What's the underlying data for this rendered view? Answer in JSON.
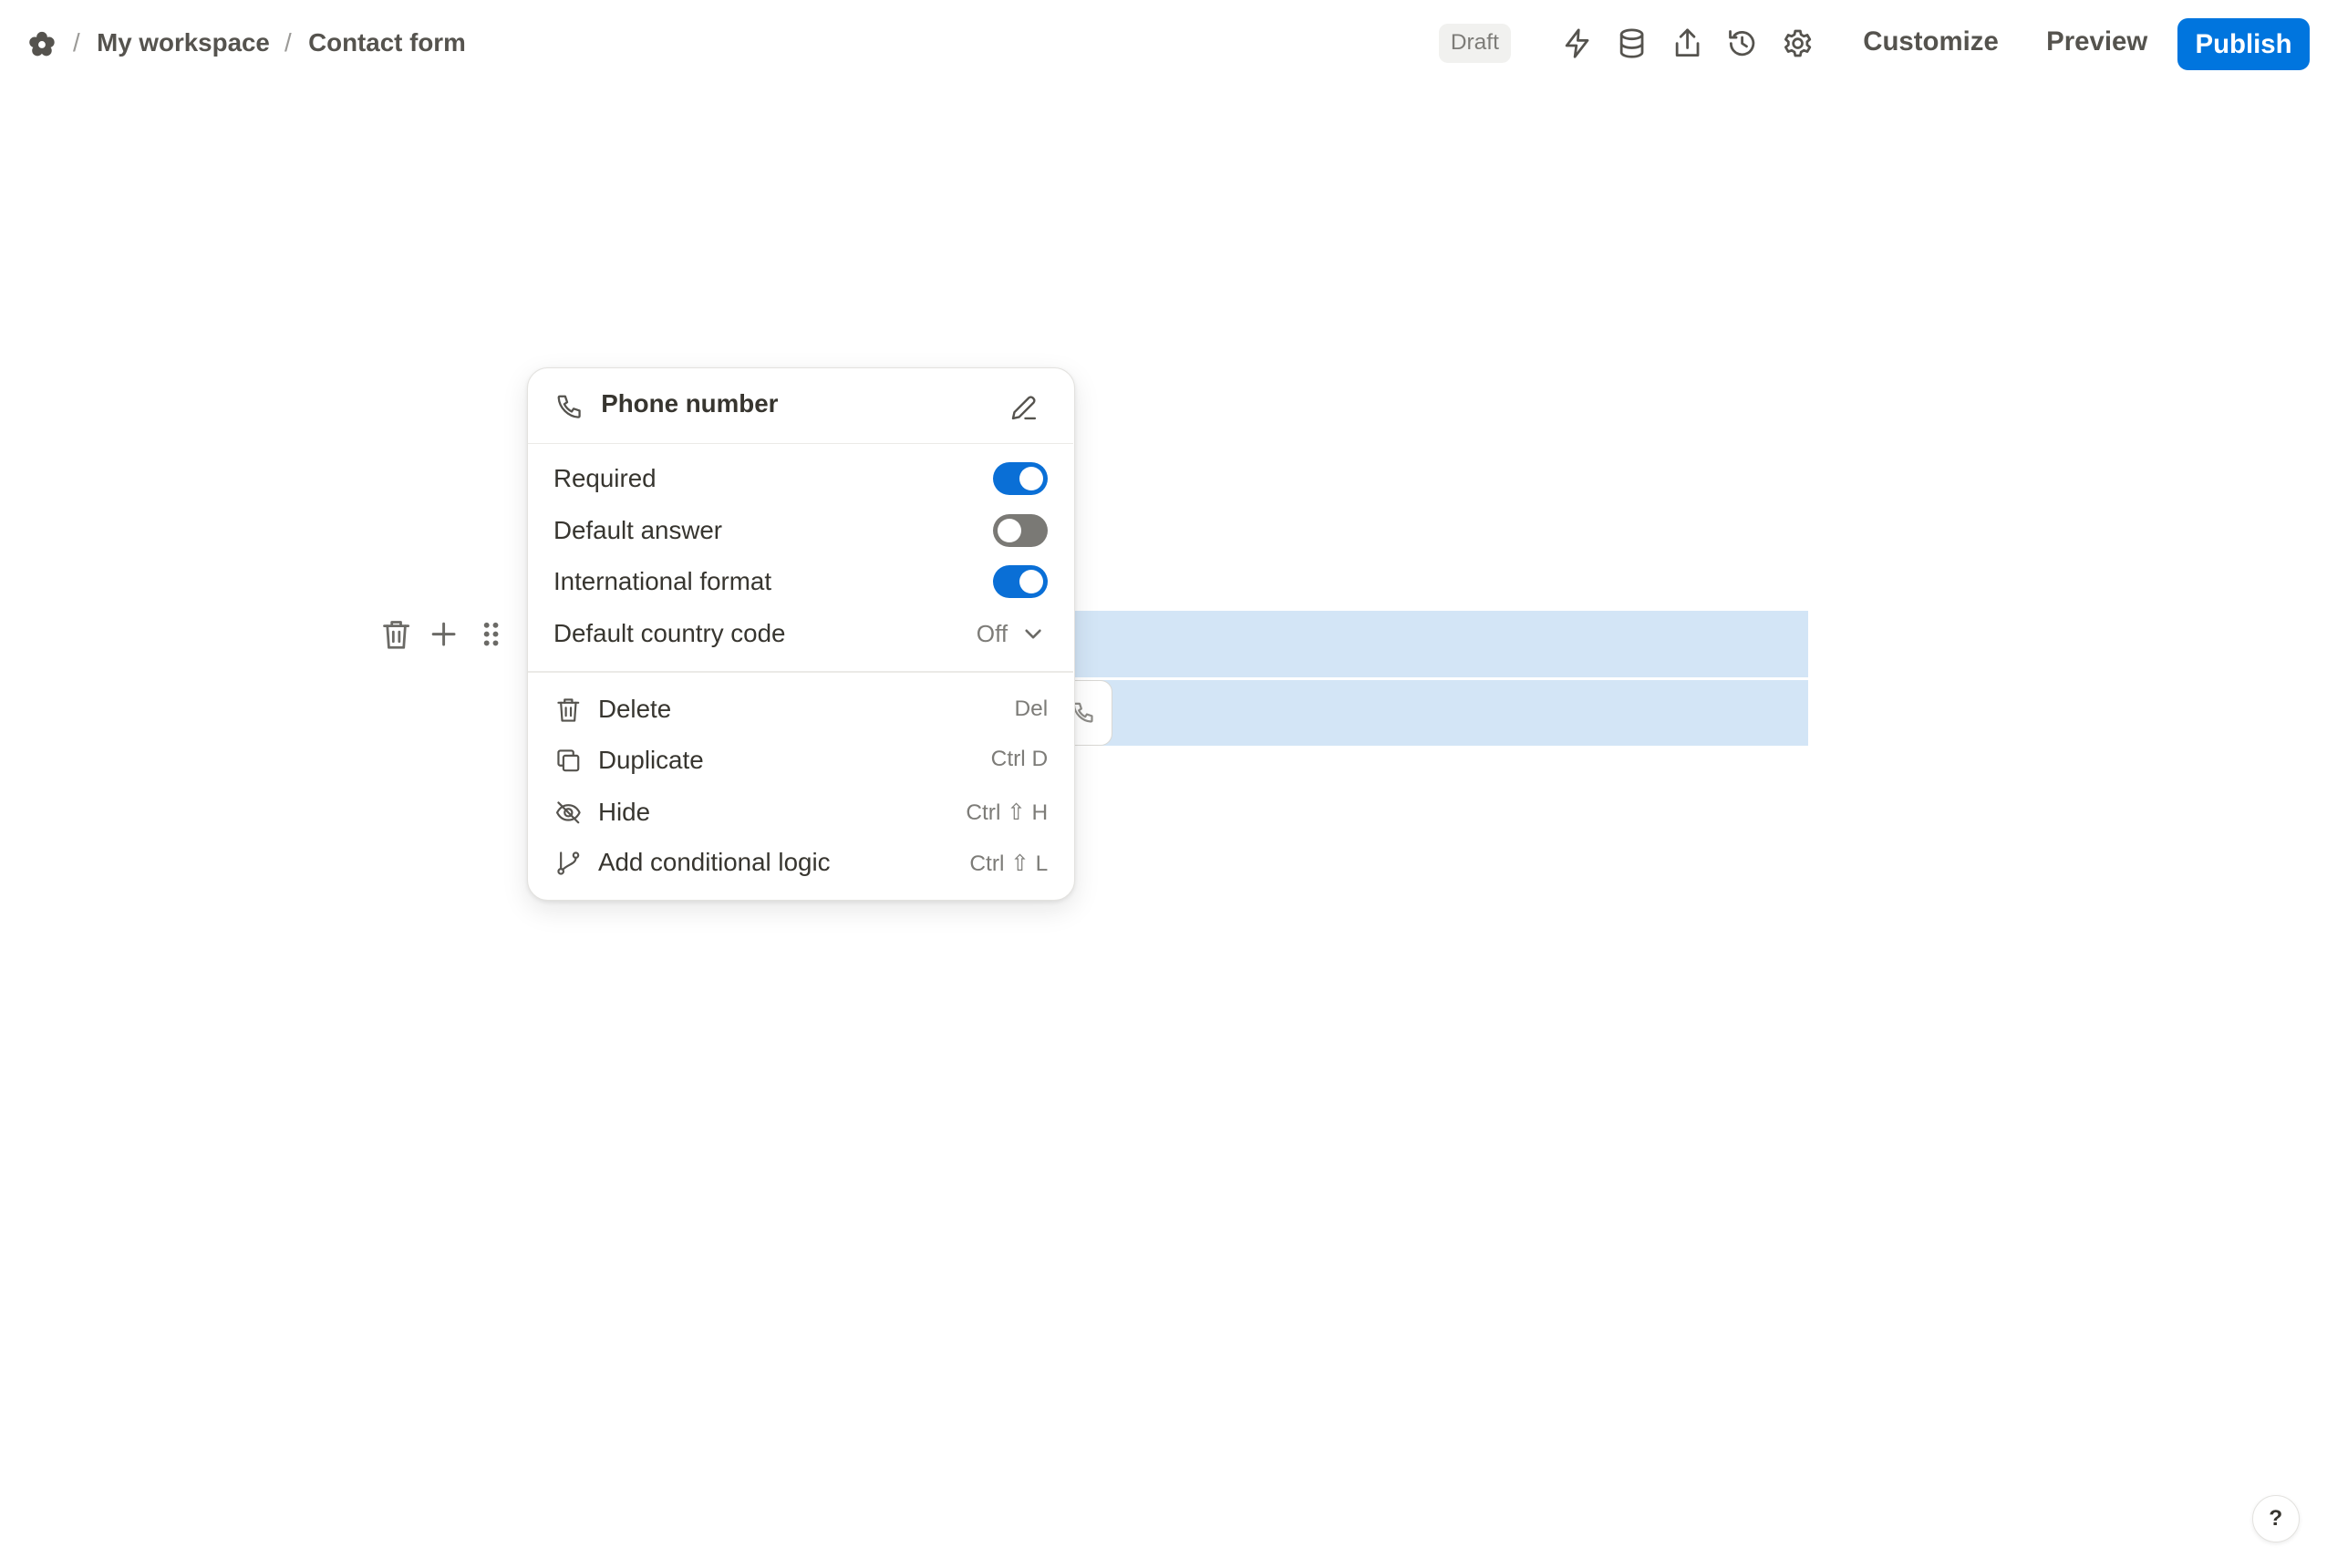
{
  "breadcrumb": {
    "separator": "/",
    "workspace": "My workspace",
    "page": "Contact form"
  },
  "topbar": {
    "status_badge": "Draft",
    "icons": [
      "bolt-icon",
      "database-icon",
      "share-icon",
      "history-icon",
      "gear-icon"
    ],
    "customize_label": "Customize",
    "preview_label": "Preview",
    "publish_label": "Publish"
  },
  "block_controls": [
    "trash-icon",
    "plus-icon",
    "drag-handle-icon"
  ],
  "field_menu": {
    "title": "Phone number",
    "options": {
      "required": {
        "label": "Required",
        "enabled": true
      },
      "default_answer": {
        "label": "Default answer",
        "enabled": false
      },
      "international_format": {
        "label": "International format",
        "enabled": true
      },
      "default_country_code": {
        "label": "Default country code",
        "value": "Off"
      }
    },
    "actions": {
      "delete": {
        "label": "Delete",
        "shortcut": "Del"
      },
      "duplicate": {
        "label": "Duplicate",
        "shortcut": "Ctrl D"
      },
      "hide": {
        "label": "Hide",
        "shortcut": "Ctrl ⇧ H"
      },
      "conditional_logic": {
        "label": "Add conditional logic",
        "shortcut": "Ctrl ⇧ L"
      }
    }
  },
  "colors": {
    "accent": "#0075de",
    "selection": "#d3e5f6",
    "toggle_on": "#0a6fd6",
    "toggle_off": "#7a7975"
  },
  "help_label": "?"
}
